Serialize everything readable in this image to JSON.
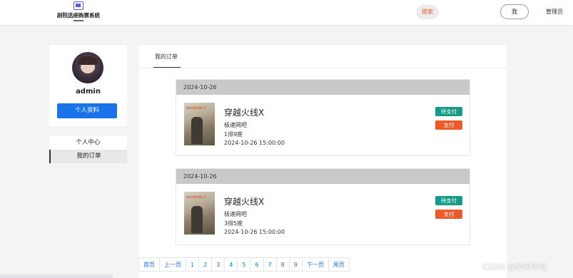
{
  "header": {
    "logo_text": "剧院选座购票系统",
    "search_label": "搜索",
    "me_label": "我",
    "admin_label": "管理员"
  },
  "profile": {
    "username": "admin",
    "profile_button": "个人资料"
  },
  "side_menu": {
    "items": [
      {
        "label": "个人中心"
      },
      {
        "label": "我的订单"
      }
    ]
  },
  "main": {
    "tab_label": "我的订单"
  },
  "orders": [
    {
      "date": "2024-10-26",
      "title": "穿越火线X",
      "venue": "极速网吧",
      "seat": "1排9座",
      "time": "2024-10-26 15:00:00",
      "status": "待支付",
      "pay_label": "支付",
      "poster_logo": "DIVISION 2"
    },
    {
      "date": "2024-10-26",
      "title": "穿越火线X",
      "venue": "极速网吧",
      "seat": "3排5座",
      "time": "2024-10-26 15:00:00",
      "status": "待支付",
      "pay_label": "支付",
      "poster_logo": "DIVISION 2"
    }
  ],
  "pagination": {
    "first": "首页",
    "prev": "上一页",
    "pages": [
      "1",
      "2",
      "3",
      "4",
      "5",
      "6",
      "7",
      "8",
      "9"
    ],
    "next": "下一页",
    "last": "尾页"
  },
  "watermark": "CSDN @岸风毕设",
  "colors": {
    "primary": "#1a73e8",
    "status_green": "#139c8a",
    "pay_orange": "#ee5a2a",
    "search_text": "#e8603c"
  }
}
